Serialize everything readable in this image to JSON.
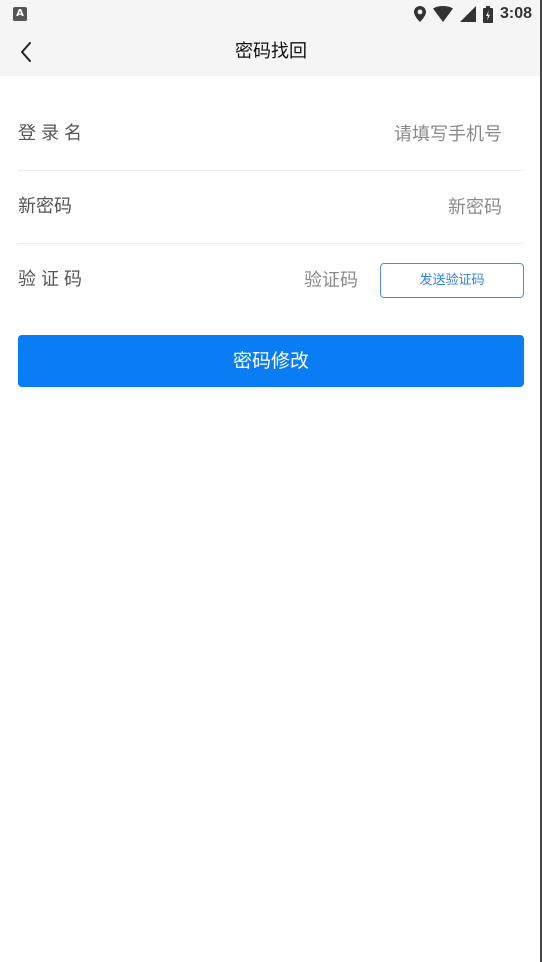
{
  "status_bar": {
    "time": "3:08",
    "icons": [
      "app-notification-icon",
      "location-icon",
      "wifi-icon",
      "cell-signal-icon",
      "battery-icon"
    ]
  },
  "app_bar": {
    "title": "密码找回",
    "back_icon": "chevron-left-icon"
  },
  "form": {
    "login": {
      "label": "登录名",
      "placeholder": "请填写手机号",
      "value": ""
    },
    "new_password": {
      "label": "新密码",
      "placeholder": "新密码",
      "value": ""
    },
    "code": {
      "label": "验证码",
      "placeholder": "验证码",
      "value": "",
      "send_button": "发送验证码"
    }
  },
  "submit_label": "密码修改",
  "colors": {
    "primary": "#0a7df5",
    "outline": "#4a8ee8",
    "bar_bg": "#f5f5f5"
  }
}
